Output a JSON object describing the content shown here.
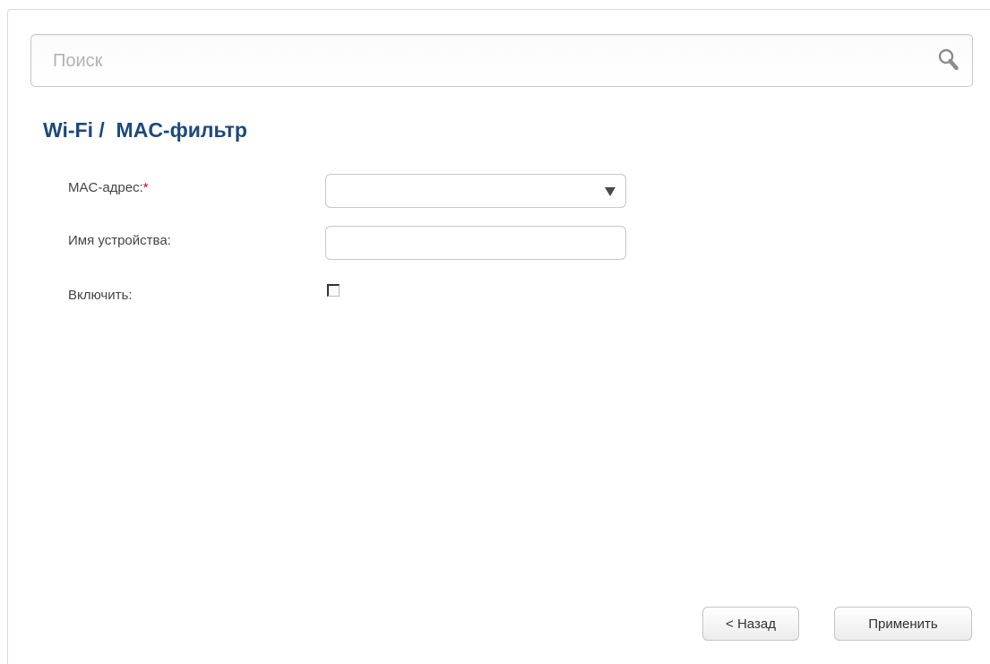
{
  "search": {
    "placeholder": "Поиск",
    "icon": "search-icon"
  },
  "page": {
    "title": "Wi-Fi /  MAC-фильтр"
  },
  "form": {
    "mac": {
      "label": "MAC-адрес:",
      "required_mark": "*",
      "value": ""
    },
    "device_name": {
      "label": "Имя устройства:",
      "value": ""
    },
    "enable": {
      "label": "Включить:",
      "checked": false
    }
  },
  "buttons": {
    "back_label": "< Назад",
    "apply_label": "Применить"
  },
  "colors": {
    "title": "#1c4a7c",
    "required": "#d0021b"
  }
}
